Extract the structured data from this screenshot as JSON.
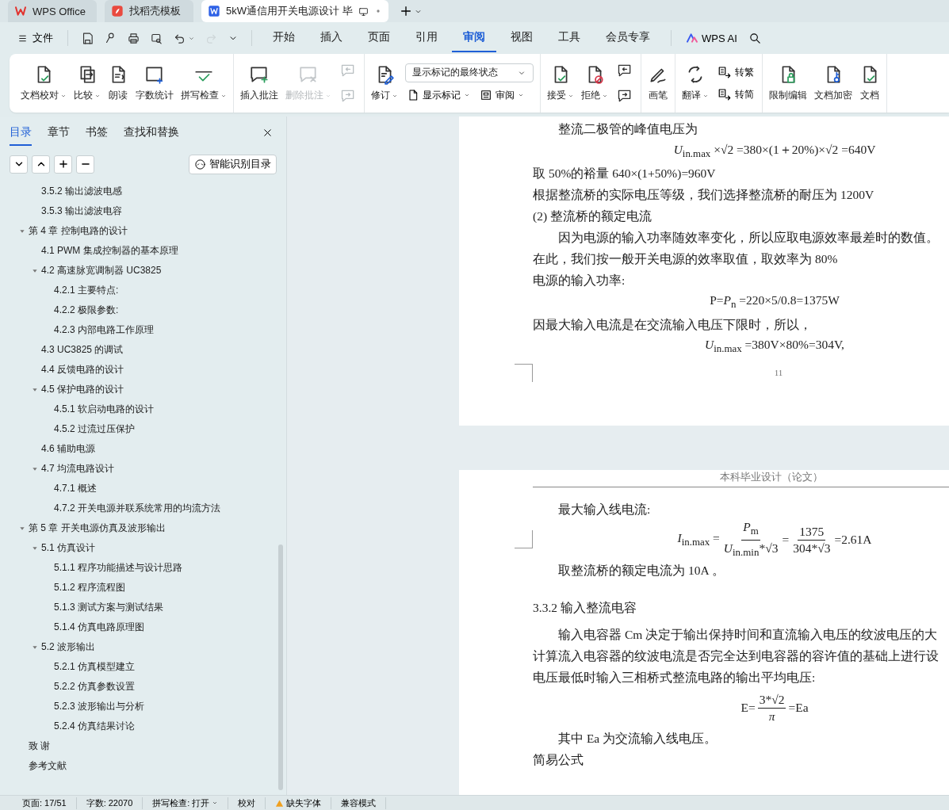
{
  "title_tabs": [
    {
      "label": "WPS Office",
      "selected": false
    },
    {
      "label": "找稻壳模板",
      "selected": false
    },
    {
      "label": "5kW通信用开关电源设计 毕",
      "selected": true
    }
  ],
  "menu": {
    "file": "文件",
    "quick_tools": [
      {
        "dropdown": false,
        "disabled": false
      },
      {
        "dropdown": false,
        "disabled": false
      },
      {
        "dropdown": false,
        "disabled": false
      },
      {
        "dropdown": false,
        "disabled": false
      },
      {
        "dropdown": true,
        "disabled": false
      },
      {
        "dropdown": false,
        "disabled": true
      }
    ],
    "tabs": [
      {
        "label": "开始",
        "selected": false
      },
      {
        "label": "插入",
        "selected": false
      },
      {
        "label": "页面",
        "selected": false
      },
      {
        "label": "引用",
        "selected": false
      },
      {
        "label": "审阅",
        "selected": true
      },
      {
        "label": "视图",
        "selected": false
      },
      {
        "label": "工具",
        "selected": false
      },
      {
        "label": "会员专享",
        "selected": false
      }
    ],
    "ai": "WPS AI"
  },
  "ribbon": {
    "groups": [
      {
        "items": [
          {
            "kind": "large",
            "label": "文档校对",
            "dropdown": true,
            "disabled": false
          },
          {
            "kind": "large",
            "label": "比较",
            "dropdown": true,
            "disabled": false
          },
          {
            "kind": "large",
            "label": "朗读",
            "dropdown": false,
            "disabled": false
          },
          {
            "kind": "large",
            "label": "字数统计",
            "dropdown": false,
            "disabled": false
          },
          {
            "kind": "large",
            "label": "拼写检查",
            "dropdown": true,
            "disabled": false
          }
        ]
      },
      {
        "items": [
          {
            "kind": "large",
            "label": "插入批注",
            "dropdown": false,
            "disabled": false
          },
          {
            "kind": "large",
            "label": "删除批注",
            "dropdown": true,
            "disabled": true
          },
          {
            "kind": "icon_stack",
            "icons": [
              {
                "disabled": true
              },
              {
                "disabled": true
              }
            ]
          }
        ]
      },
      {
        "items": [
          {
            "kind": "large",
            "label": "修订",
            "dropdown": true,
            "disabled": false
          },
          {
            "kind": "select_stack",
            "select": "显示标记的最终状态",
            "buttons": [
              {
                "label": "显示标记",
                "dropdown": true
              },
              {
                "label": "审阅",
                "dropdown": true
              }
            ]
          }
        ]
      },
      {
        "items": [
          {
            "kind": "large",
            "label": "接受",
            "dropdown": true,
            "disabled": false
          },
          {
            "kind": "large",
            "label": "拒绝",
            "dropdown": true,
            "disabled": false
          },
          {
            "kind": "icon_stack",
            "icons": [
              {
                "disabled": false
              },
              {
                "disabled": false
              }
            ]
          }
        ]
      },
      {
        "items": [
          {
            "kind": "large",
            "label": "画笔",
            "dropdown": false,
            "disabled": false
          }
        ]
      },
      {
        "items": [
          {
            "kind": "large",
            "label": "翻译",
            "dropdown": true,
            "disabled": false
          },
          {
            "kind": "small_stack",
            "buttons": [
              {
                "label": "转繁",
                "dropdown": false
              },
              {
                "label": "转简",
                "dropdown": false
              }
            ]
          }
        ]
      },
      {
        "items": [
          {
            "kind": "large",
            "label": "限制编辑",
            "dropdown": false,
            "disabled": false
          },
          {
            "kind": "large",
            "label": "文档加密",
            "dropdown": false,
            "disabled": false
          },
          {
            "kind": "large",
            "label": "文档",
            "dropdown": false,
            "disabled": false
          }
        ]
      }
    ]
  },
  "nav": {
    "tabs": [
      {
        "label": "目录",
        "selected": true
      },
      {
        "label": "章节",
        "selected": false
      },
      {
        "label": "书签",
        "selected": false
      },
      {
        "label": "查找和替换",
        "selected": false
      }
    ],
    "smart_button": "智能识别目录",
    "toc": [
      {
        "children": [
          {
            "children": [
              {
                "label": "3.5.2 输出滤波电感"
              },
              {
                "label": "3.5.3  输出滤波电容"
              }
            ]
          }
        ]
      },
      {
        "label": "第 4 章  控制电路的设计",
        "expanded": true,
        "children": [
          {
            "label": "4.1 PWM 集成控制器的基本原理"
          },
          {
            "label": "4.2  高速脉宽调制器 UC3825",
            "expanded": true,
            "children": [
              {
                "label": "4.2.1  主要特点:"
              },
              {
                "label": "4.2.2  极限参数:"
              },
              {
                "label": "4.2.3  内部电路工作原理"
              }
            ]
          },
          {
            "label": "4.3    UC3825 的调试"
          },
          {
            "label": "4.4  反馈电路的设计"
          },
          {
            "label": "4.5 保护电路的设计",
            "expanded": true,
            "children": [
              {
                "label": "4.5.1 软启动电路的设计"
              },
              {
                "label": "4.5.2 过流过压保护"
              }
            ]
          },
          {
            "label": "4.6  辅助电源"
          },
          {
            "label": "4.7  均流电路设计",
            "expanded": true,
            "children": [
              {
                "label": "4.7.1  概述"
              },
              {
                "label": "4.7.2  开关电源并联系统常用的均流方法"
              }
            ]
          }
        ]
      },
      {
        "label": "第 5 章  开关电源仿真及波形输出",
        "expanded": true,
        "children": [
          {
            "label": "5.1 仿真设计",
            "expanded": true,
            "children": [
              {
                "label": "5.1.1 程序功能描述与设计思路"
              },
              {
                "label": "5.1.2 程序流程图"
              },
              {
                "label": "5.1.3 测试方案与测试结果"
              },
              {
                "label": "5.1.4 仿真电路原理图"
              }
            ]
          },
          {
            "label": "5.2  波形输出",
            "expanded": true,
            "children": [
              {
                "label": "5.2.1  仿真模型建立"
              },
              {
                "label": "5.2.2  仿真参数设置"
              },
              {
                "label": "5.2.3  波形输出与分析"
              },
              {
                "label": "5.2.4  仿真结果讨论"
              }
            ]
          }
        ]
      },
      {
        "label": "致    谢"
      },
      {
        "label": "参考文献"
      }
    ]
  },
  "pages": [
    {
      "blocks": [
        {
          "kind": "indent",
          "text": "整流二极管的峰值电压为"
        },
        {
          "kind": "formula",
          "parts": [
            {
              "kind": "text",
              "text": "*U*$_{in.max}$ ×√2 =380×(1＋20%)×√2 =640V"
            }
          ]
        },
        {
          "kind": "para",
          "text": "取 50%的裕量  640×(1+50%)=960V"
        },
        {
          "kind": "para",
          "text": "根据整流桥的实际电压等级，我们选择整流桥的耐压为 1200V"
        },
        {
          "kind": "para",
          "text": "(2)  整流桥的额定电流"
        },
        {
          "kind": "indent",
          "text": "因为电源的输入功率随效率变化，所以应取电源效率最差时的数值。"
        },
        {
          "kind": "para",
          "text": "在此，我们按一般开关电源的效率取值，取效率为 80%"
        },
        {
          "kind": "para",
          "text": "电源的输入功率:"
        },
        {
          "kind": "formula",
          "parts": [
            {
              "kind": "text",
              "text": "P=*P*$_{n}$  =220×5/0.8=1375W"
            }
          ]
        },
        {
          "kind": "para",
          "text": "因最大输入电流是在交流输入电压下限时，所以，"
        },
        {
          "kind": "formula",
          "parts": [
            {
              "kind": "text",
              "text": "*U*$_{in.max}$ =380V×80%=304V,"
            }
          ]
        }
      ],
      "page_number": "11"
    },
    {
      "header": "本科毕业设计（论文）",
      "blocks": [
        {
          "kind": "indent",
          "text": "最大输入线电流:"
        },
        {
          "kind": "formula",
          "parts": [
            {
              "kind": "text",
              "text": "*I*$_{in.max}$ ="
            },
            {
              "kind": "frac",
              "num": "*P*$_{m}$",
              "den": "*U*$_{in.min}$*√3"
            },
            {
              "kind": "text",
              "text": "="
            },
            {
              "kind": "frac",
              "num": "1375",
              "den": "304*√3"
            },
            {
              "kind": "text",
              "text": "=2.61A"
            }
          ]
        },
        {
          "kind": "indent",
          "text": "取整流桥的额定电流为 10A  。"
        },
        {
          "kind": "heading",
          "text": "3.3.2  输入整流电容"
        },
        {
          "kind": "indent",
          "text": "输入电容器 Cm 决定于输出保持时间和直流输入电压的纹波电压的大"
        },
        {
          "kind": "para",
          "text": "计算流入电容器的纹波电流是否完全达到电容器的容许值的基础上进行设"
        },
        {
          "kind": "para",
          "text": "电压最低时输入三相桥式整流电路的输出平均电压:"
        },
        {
          "kind": "formula",
          "parts": [
            {
              "kind": "text",
              "text": "E="
            },
            {
              "kind": "frac",
              "num": "3*√2",
              "den": "*π*"
            },
            {
              "kind": "text",
              "text": "=Ea"
            }
          ]
        },
        {
          "kind": "indent",
          "text": "其中 Ea 为交流输入线电压。"
        },
        {
          "kind": "para",
          "text": "简易公式"
        }
      ]
    }
  ],
  "status_bar": [
    {
      "kind": "text",
      "label": "页面: 17/51"
    },
    {
      "kind": "text",
      "label": "字数: 22070"
    },
    {
      "kind": "dropdown",
      "label": "拼写检查: 打开"
    },
    {
      "kind": "text",
      "label": "校对"
    },
    {
      "kind": "warning",
      "label": "缺失字体"
    },
    {
      "kind": "text",
      "label": "兼容模式"
    }
  ]
}
